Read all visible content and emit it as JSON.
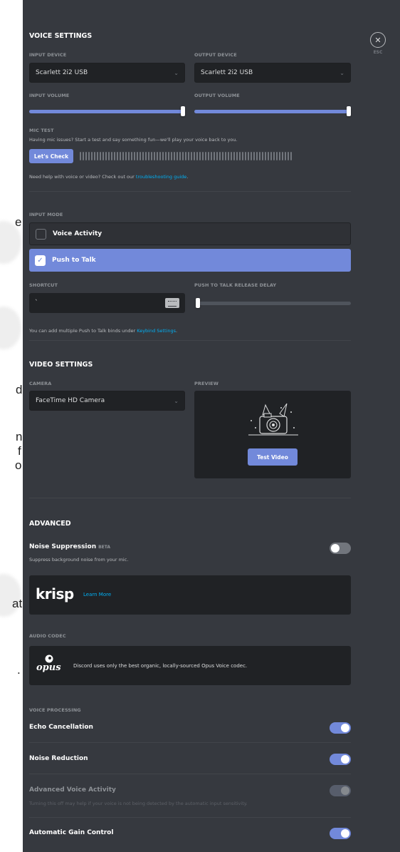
{
  "background_doc": {
    "letters": [
      "e",
      "d",
      "n",
      "f",
      "o",
      "at",
      "."
    ]
  },
  "voice_settings": {
    "title": "VOICE SETTINGS",
    "input_device": {
      "label": "INPUT DEVICE",
      "value": "Scarlett 2i2 USB"
    },
    "output_device": {
      "label": "OUTPUT DEVICE",
      "value": "Scarlett 2i2 USB"
    },
    "input_volume": {
      "label": "INPUT VOLUME",
      "level": 1.0
    },
    "output_volume": {
      "label": "OUTPUT VOLUME",
      "level": 1.0
    },
    "mic_test": {
      "label": "MIC TEST",
      "description": "Having mic issues? Start a test and say something fun—we'll play your voice back to you.",
      "button": "Let's Check"
    },
    "help_prefix": "Need help with voice or video? Check out our ",
    "help_link": "troubleshooting guide",
    "help_suffix": "."
  },
  "input_mode": {
    "label": "INPUT MODE",
    "options": [
      {
        "label": "Voice Activity",
        "checked": false
      },
      {
        "label": "Push to Talk",
        "checked": true
      }
    ],
    "shortcut": {
      "label": "SHORTCUT",
      "value": "`"
    },
    "release_delay": {
      "label": "PUSH TO TALK RELEASE DELAY",
      "level": 0.0
    },
    "keybind_prefix": "You can add multiple Push to Talk binds under ",
    "keybind_link": "Keybind Settings",
    "keybind_suffix": "."
  },
  "video_settings": {
    "title": "VIDEO SETTINGS",
    "camera": {
      "label": "CAMERA",
      "value": "FaceTime HD Camera"
    },
    "preview": {
      "label": "PREVIEW",
      "button": "Test Video"
    }
  },
  "advanced": {
    "title": "ADVANCED",
    "noise_suppression": {
      "title": "Noise Suppression",
      "badge": "BETA",
      "description": "Suppress background noise from your mic.",
      "enabled": false
    },
    "krisp": {
      "logo": "krisp",
      "link": "Learn More"
    },
    "audio_codec": {
      "label": "AUDIO CODEC",
      "logo": "opus",
      "description": "Discord uses only the best organic, locally-sourced Opus Voice codec."
    },
    "voice_processing": {
      "label": "VOICE PROCESSING",
      "items": [
        {
          "title": "Echo Cancellation",
          "enabled": true
        },
        {
          "title": "Noise Reduction",
          "enabled": true
        },
        {
          "title": "Advanced Voice Activity",
          "description": "Turning this off may help if your voice is not being detected by the automatic input sensitivity.",
          "enabled": true,
          "disabled": true
        },
        {
          "title": "Automatic Gain Control",
          "enabled": true
        }
      ]
    }
  },
  "close": {
    "icon": "close-icon",
    "label": "ESC"
  },
  "colors": {
    "background": "#36393f",
    "accent": "#7289da",
    "link": "#00b0f4",
    "input_bg": "#202225"
  }
}
